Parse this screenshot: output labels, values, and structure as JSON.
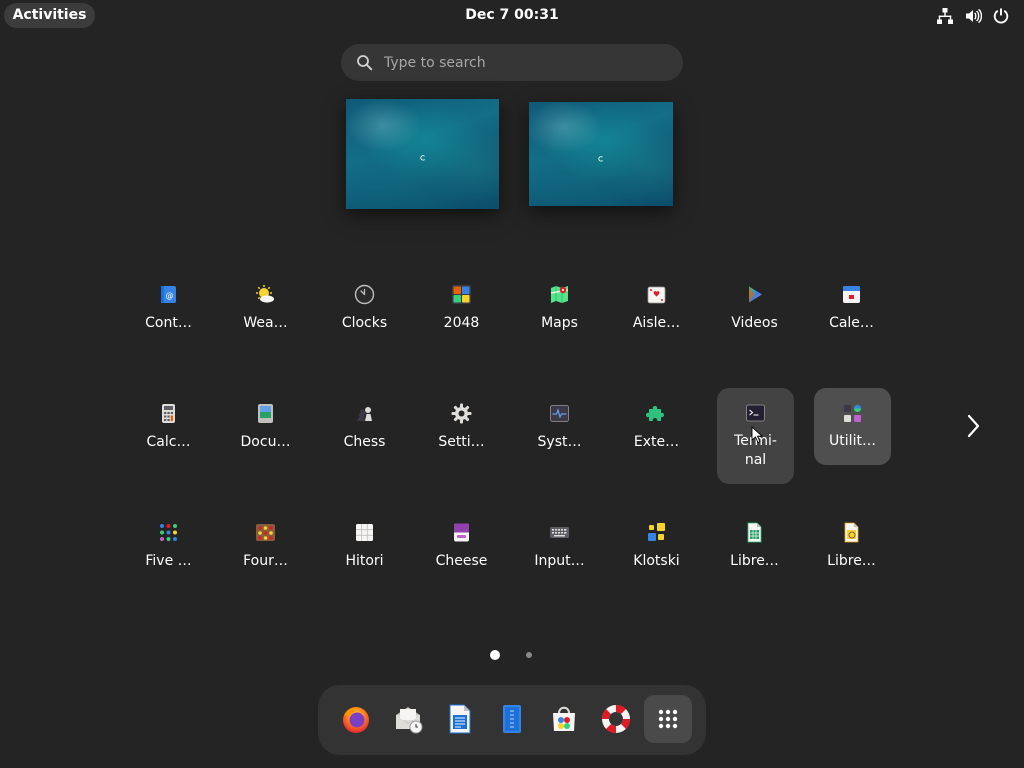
{
  "topbar": {
    "activities_label": "Activities",
    "clock": "Dec 7  00:31",
    "tray_icons": [
      "network-wired-icon",
      "volume-icon",
      "power-icon"
    ]
  },
  "search": {
    "placeholder": "Type to search",
    "icon": "search-icon"
  },
  "workspaces": [
    {
      "name": "Workspace 1"
    },
    {
      "name": "Workspace 2"
    }
  ],
  "app_grid": {
    "page": 1,
    "page_count": 2,
    "rows": [
      [
        {
          "label": "Cont…",
          "icon": "contacts-icon"
        },
        {
          "label": "Wea…",
          "icon": "weather-icon"
        },
        {
          "label": "Clocks",
          "icon": "clocks-icon"
        },
        {
          "label": "2048",
          "icon": "game-2048-icon"
        },
        {
          "label": "Maps",
          "icon": "maps-icon"
        },
        {
          "label": "Aisle…",
          "icon": "aisleriot-cards-icon"
        },
        {
          "label": "Videos",
          "icon": "videos-icon"
        },
        {
          "label": "Cale…",
          "icon": "calendar-icon"
        }
      ],
      [
        {
          "label": "Calc…",
          "icon": "calculator-icon"
        },
        {
          "label": "Docu…",
          "icon": "document-viewer-icon"
        },
        {
          "label": "Chess",
          "icon": "chess-icon"
        },
        {
          "label": "Setti…",
          "icon": "settings-gear-icon"
        },
        {
          "label": "Syst…",
          "icon": "system-monitor-icon"
        },
        {
          "label": "Exte…",
          "icon": "extensions-puzzle-icon"
        },
        {
          "label": "Termi-",
          "label2": "nal",
          "icon": "terminal-icon",
          "state": "hovered"
        },
        {
          "label": "Utilit…",
          "icon": "utilities-folder-icon",
          "state": "selected"
        }
      ],
      [
        {
          "label": "Five …",
          "icon": "five-or-more-icon"
        },
        {
          "label": "Four…",
          "icon": "four-in-a-row-icon"
        },
        {
          "label": "Hitori",
          "icon": "hitori-icon"
        },
        {
          "label": "Cheese",
          "icon": "cheese-webcam-icon"
        },
        {
          "label": "Input…",
          "icon": "input-method-keyboard-icon"
        },
        {
          "label": "Klotski",
          "icon": "klotski-icon"
        },
        {
          "label": "Libre…",
          "icon": "libreoffice-calc-icon"
        },
        {
          "label": "Libre…",
          "icon": "libreoffice-draw-icon"
        }
      ]
    ]
  },
  "dash": {
    "items": [
      {
        "name": "Firefox",
        "icon": "firefox-icon"
      },
      {
        "name": "Evolution",
        "icon": "mail-clock-icon"
      },
      {
        "name": "LibreOffice Writer",
        "icon": "libreoffice-writer-icon"
      },
      {
        "name": "Text Editor",
        "icon": "text-editor-icon"
      },
      {
        "name": "Software",
        "icon": "software-store-icon"
      },
      {
        "name": "Help",
        "icon": "help-lifebuoy-icon"
      },
      {
        "name": "Show Apps",
        "icon": "show-apps-grid-icon",
        "state": "active"
      }
    ]
  },
  "colors": {
    "background": "#242424",
    "topbar_pill": "#3c3c3c",
    "search_bg": "#363636",
    "dash_bg": "#333333",
    "hover_bg": "#434343",
    "selected_bg": "#4f4f4f",
    "accent_blue": "#3584e4"
  }
}
